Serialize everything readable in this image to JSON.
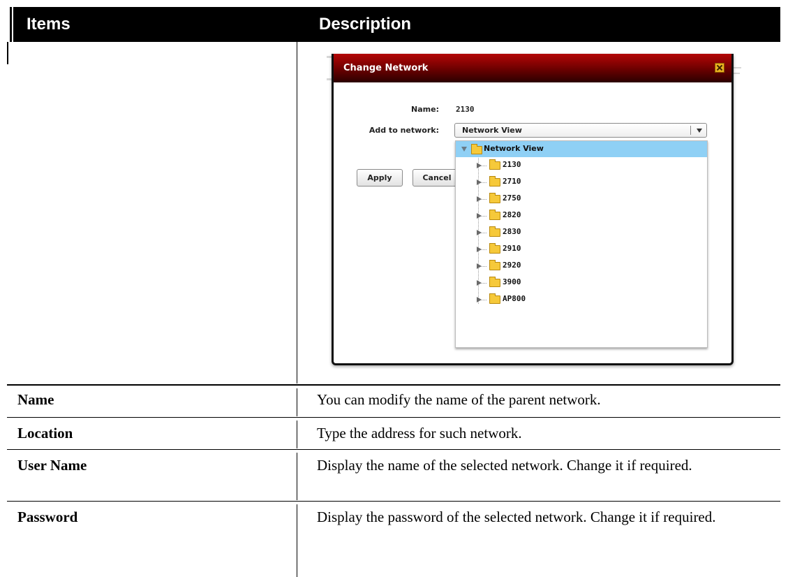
{
  "table": {
    "header": {
      "items": "Items",
      "description": "Description"
    },
    "rows": [
      {
        "item": "Name",
        "description": "You can modify the name of the parent network."
      },
      {
        "item": "Location",
        "description": "Type the address for such network."
      },
      {
        "item": "User Name",
        "description": "Display the name of the selected network. Change it if required."
      },
      {
        "item": "Password",
        "description": "Display the password of the selected network. Change it if required."
      }
    ]
  },
  "dialog": {
    "title": "Change Network",
    "name_label": "Name:",
    "name_value": "2130",
    "network_label": "Add to network:",
    "network_selected": "Network View",
    "apply_label": "Apply",
    "cancel_label": "Cancel",
    "tree": {
      "root": "Network View",
      "children": [
        "2130",
        "2710",
        "2750",
        "2820",
        "2830",
        "2910",
        "2920",
        "3900",
        "AP800"
      ]
    }
  },
  "colors": {
    "header_bg": "#000000",
    "title_bar": "#8a0000",
    "tree_highlight": "#8fd0f5",
    "folder": "#f6c93a"
  },
  "icons": [
    "close-icon",
    "dropdown-arrow-icon",
    "expand-arrow-icon",
    "collapse-arrow-icon",
    "folder-icon"
  ]
}
